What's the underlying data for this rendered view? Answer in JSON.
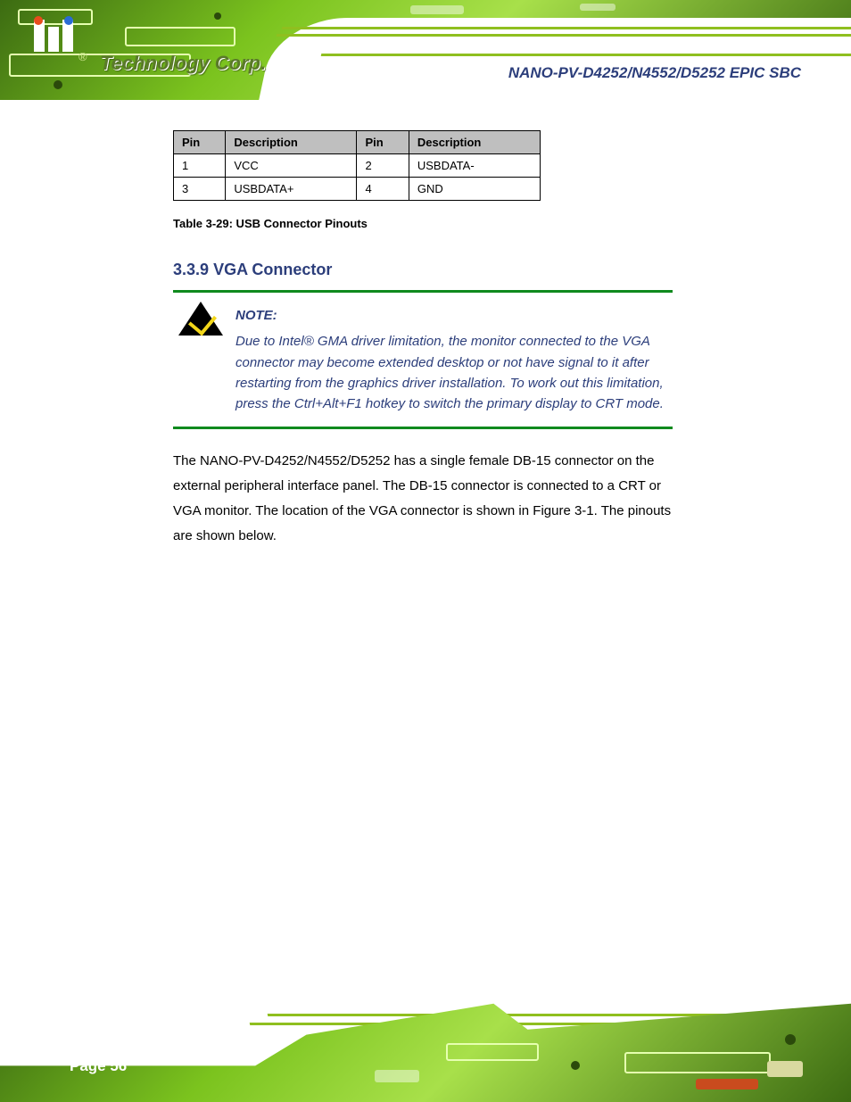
{
  "header": {
    "logo_tagline": "Technology Corp.",
    "registered": "®",
    "document_title": "NANO-PV-D4252/N4552/D5252 EPIC SBC"
  },
  "table": {
    "headers": [
      "Pin",
      "Description",
      "Pin",
      "Description"
    ],
    "rows": [
      [
        "1",
        "VCC",
        "2",
        "USBDATA-"
      ],
      [
        "3",
        "USBDATA+",
        "4",
        "GND"
      ]
    ]
  },
  "caption": "Table 3-29: USB Connector Pinouts",
  "section": {
    "number": "3.3.9",
    "title": "VGA Connector"
  },
  "note": {
    "heading": "NOTE:",
    "body": "Due to Intel® GMA driver limitation, the monitor connected to the VGA connector may become extended desktop or not have signal to it after restarting from the graphics driver installation. To work out this limitation, press the Ctrl+Alt+F1 hotkey to switch the primary display to CRT mode."
  },
  "paragraph": "The NANO-PV-D4252/N4552/D5252 has a single female DB-15 connector on the external peripheral interface panel. The DB-15 connector is connected to a CRT or VGA monitor. The location of the VGA connector is shown in Figure 3-1. The pinouts are shown below.",
  "footer": {
    "page_number": "Page 56"
  }
}
